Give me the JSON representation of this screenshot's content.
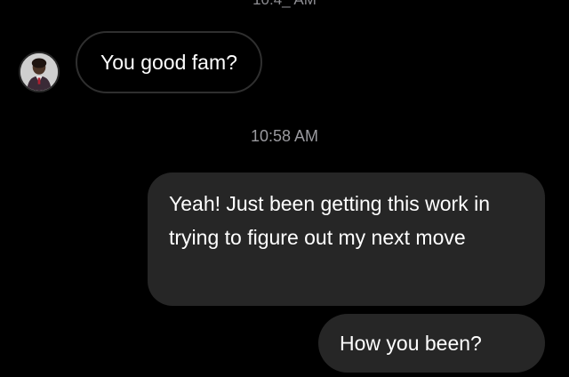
{
  "thread": {
    "top_timestamp": "10:4_ AM",
    "messages": [
      {
        "direction": "received",
        "text": "You good fam?"
      },
      {
        "type": "timestamp",
        "text": "10:58 AM"
      },
      {
        "direction": "sent",
        "text": "Yeah! Just been getting this work in trying to figure out my next move"
      },
      {
        "direction": "sent",
        "text": "How you been?"
      }
    ]
  },
  "colors": {
    "background": "#000000",
    "sent_bubble": "#262626",
    "received_bubble_border": "#2f2f2f",
    "timestamp_text": "#9a9a9f"
  },
  "icons": {
    "avatar": "contact-avatar"
  }
}
